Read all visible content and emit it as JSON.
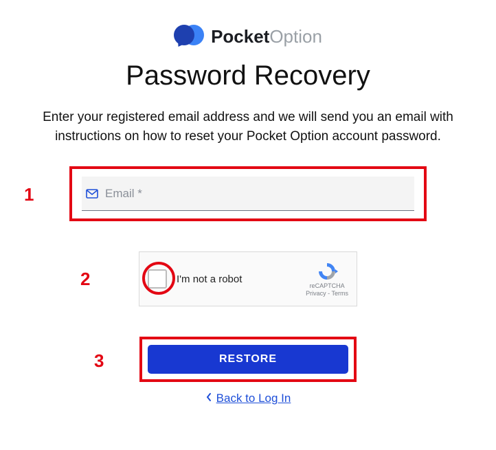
{
  "brand": {
    "bold": "Pocket",
    "light": "Option"
  },
  "page": {
    "title": "Password Recovery",
    "subtitle": "Enter your registered email address and we will send you an email with instructions on how to reset your Pocket Option account password."
  },
  "annotations": {
    "step1": "1",
    "step2": "2",
    "step3": "3"
  },
  "form": {
    "email_placeholder": "Email *",
    "captcha_label": "I'm not a robot",
    "captcha_brand": "reCAPTCHA",
    "captcha_legal": "Privacy - Terms",
    "restore_label": "RESTORE",
    "back_label": "Back to Log In"
  }
}
